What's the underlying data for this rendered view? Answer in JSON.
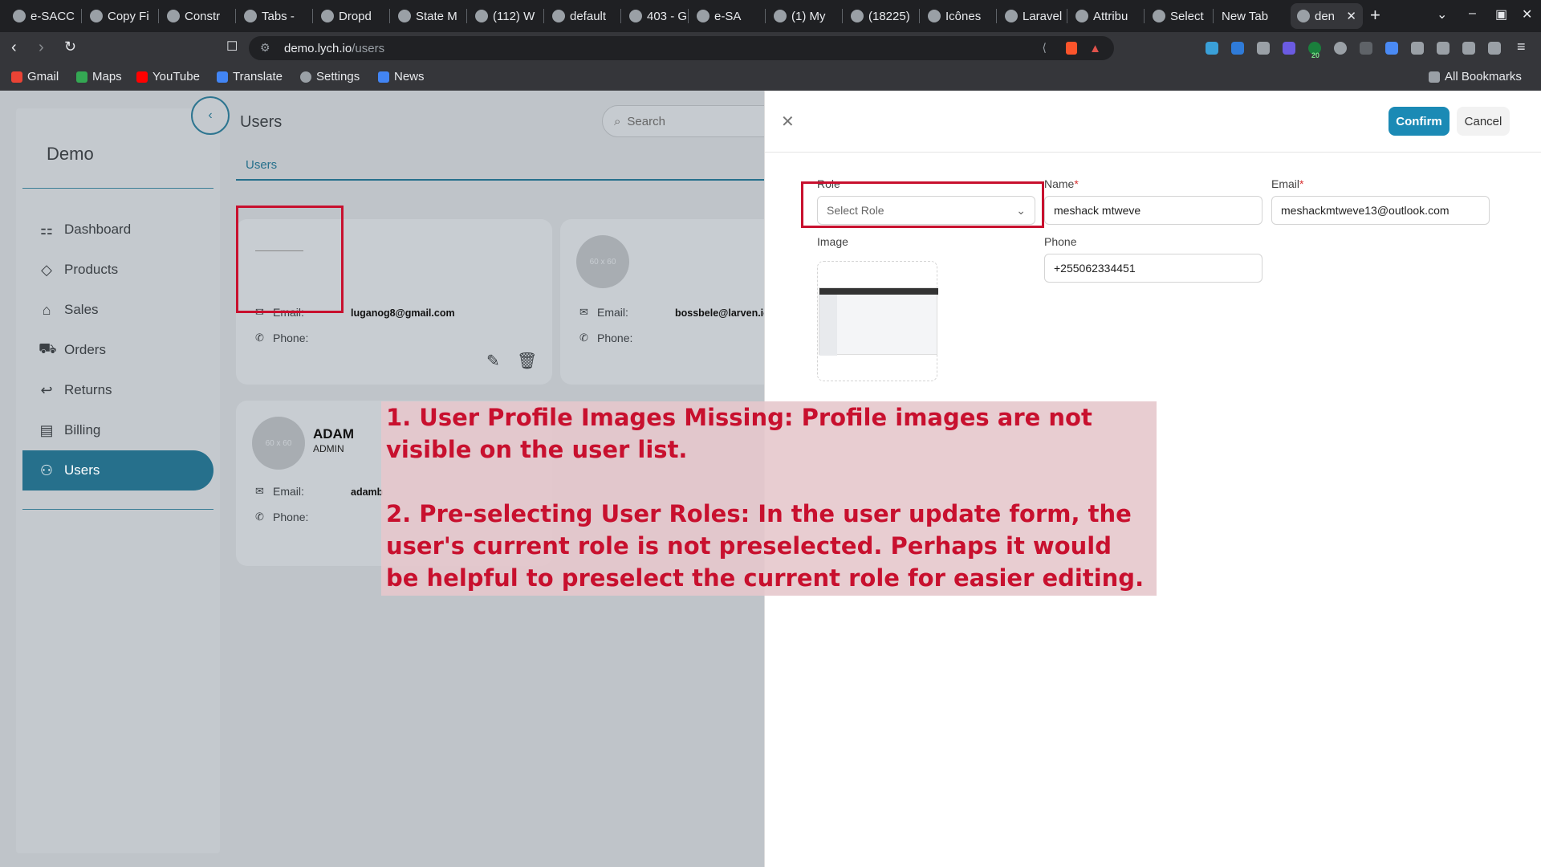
{
  "browser": {
    "tabs": [
      "e-SACC",
      "Copy Fi",
      "Constr",
      "Tabs -",
      "Dropd",
      "State M",
      "(112) W",
      "default",
      "403 - G",
      "e-SA",
      "(1) My",
      "(18225)",
      "Icônes",
      "Laravel",
      "Attribu",
      "Select",
      "New Tab",
      "den"
    ],
    "url_host": "demo.lych.io",
    "url_path": "/users",
    "bookmarks": [
      "Gmail",
      "Maps",
      "YouTube",
      "Translate",
      "Settings",
      "News"
    ],
    "all_bookmarks": "All Bookmarks",
    "extension_badge": "20"
  },
  "app": {
    "brand": "Demo",
    "nav": [
      {
        "label": "Dashboard",
        "icon": "dashboard-icon"
      },
      {
        "label": "Products",
        "icon": "diamond-icon"
      },
      {
        "label": "Sales",
        "icon": "tag-icon"
      },
      {
        "label": "Orders",
        "icon": "cart-icon"
      },
      {
        "label": "Returns",
        "icon": "return-icon"
      },
      {
        "label": "Billing",
        "icon": "billing-icon"
      },
      {
        "label": "Users",
        "icon": "user-icon",
        "active": true
      }
    ],
    "page_title": "Users",
    "search_placeholder": "Search",
    "tab": "Users",
    "cards": [
      {
        "name": "",
        "role": "",
        "email_label": "Email:",
        "email": "luganog8@gmail.com",
        "phone_label": "Phone:",
        "avatar": ""
      },
      {
        "name": "",
        "role": "",
        "email_label": "Email:",
        "email": "bossbele@larven.io",
        "phone_label": "Phone:",
        "avatar": "60 x 60"
      },
      {
        "name": "ADAM",
        "role": "ADMIN",
        "email_label": "Email:",
        "email": "adamb",
        "phone_label": "Phone:",
        "avatar": "60 x 60"
      }
    ]
  },
  "drawer": {
    "confirm": "Confirm",
    "cancel": "Cancel",
    "role_label": "Role",
    "role_placeholder": "Select Role",
    "name_label": "Name",
    "name_value": "meshack mtweve",
    "email_label": "Email",
    "email_value": "meshackmtweve13@outlook.com",
    "image_label": "Image",
    "phone_label": "Phone",
    "phone_value": "+255062334451",
    "required_mark": "*"
  },
  "annotation": {
    "note1": "1. User Profile Images Missing: Profile images are not visible on the user list.",
    "note2": "2. Pre-selecting User Roles: In the user update form, the user's current role is not preselected. Perhaps it would be helpful to preselect the current role for easier editing.",
    "color": "#c8102e"
  }
}
